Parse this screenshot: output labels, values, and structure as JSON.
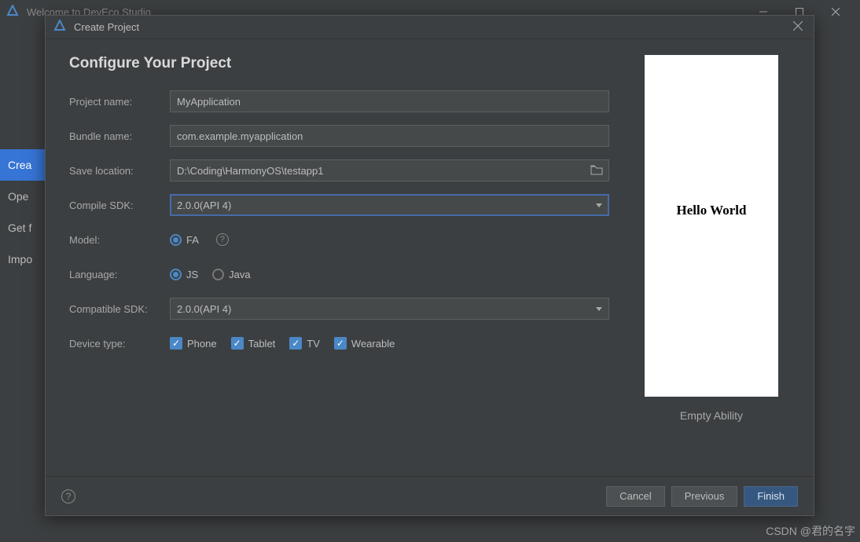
{
  "main_window": {
    "title": "Welcome to DevEco Studio"
  },
  "sidebar": {
    "items": [
      "Crea",
      "Ope",
      "Get f",
      "Impo"
    ]
  },
  "dialog": {
    "title": "Create Project",
    "heading": "Configure Your Project",
    "labels": {
      "project_name": "Project name:",
      "bundle_name": "Bundle name:",
      "save_location": "Save location:",
      "compile_sdk": "Compile SDK:",
      "model": "Model:",
      "language": "Language:",
      "compatible_sdk": "Compatible SDK:",
      "device_type": "Device type:"
    },
    "values": {
      "project_name": "MyApplication",
      "bundle_name": "com.example.myapplication",
      "save_location": "D:\\Coding\\HarmonyOS\\testapp1",
      "compile_sdk": "2.0.0(API 4)",
      "compatible_sdk": "2.0.0(API 4)"
    },
    "model_options": [
      "FA"
    ],
    "language_options": [
      "JS",
      "Java"
    ],
    "device_types": [
      "Phone",
      "Tablet",
      "TV",
      "Wearable"
    ]
  },
  "preview": {
    "text": "Hello World",
    "label": "Empty Ability"
  },
  "footer": {
    "cancel": "Cancel",
    "previous": "Previous",
    "finish": "Finish"
  },
  "watermark": "CSDN @君的名字"
}
